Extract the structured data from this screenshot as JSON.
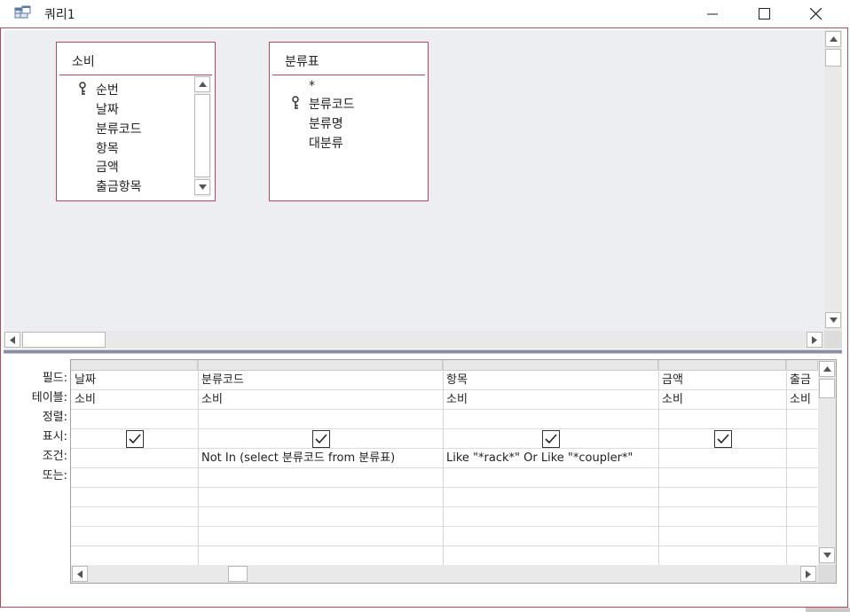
{
  "window": {
    "title": "쿼리1",
    "icon": "query-icon"
  },
  "tables": [
    {
      "title": "소비",
      "fields": [
        {
          "name": "순번",
          "key": true
        },
        {
          "name": "날짜",
          "key": false
        },
        {
          "name": "분류코드",
          "key": false
        },
        {
          "name": "항목",
          "key": false
        },
        {
          "name": "금액",
          "key": false
        },
        {
          "name": "출금항목",
          "key": false
        }
      ]
    },
    {
      "title": "분류표",
      "fields": [
        {
          "name": "*",
          "key": false
        },
        {
          "name": "분류코드",
          "key": true
        },
        {
          "name": "분류명",
          "key": false
        },
        {
          "name": "대분류",
          "key": false
        }
      ]
    }
  ],
  "grid": {
    "row_labels": [
      "필드:",
      "테이블:",
      "정렬:",
      "표시:",
      "조건:",
      "또는:"
    ],
    "columns": [
      {
        "field": "날짜",
        "table": "소비",
        "sort": "",
        "show": true,
        "criteria": ""
      },
      {
        "field": "분류코드",
        "table": "소비",
        "sort": "",
        "show": true,
        "criteria": "Not In (select 분류코드 from 분류표)"
      },
      {
        "field": "항목",
        "table": "소비",
        "sort": "",
        "show": true,
        "criteria": "Like \"*rack*\" Or Like \"*coupler*\""
      },
      {
        "field": "금액",
        "table": "소비",
        "sort": "",
        "show": true,
        "criteria": ""
      },
      {
        "field": "출금",
        "table": "소비",
        "sort": "",
        "show": false,
        "criteria": ""
      }
    ]
  },
  "colors": {
    "accent": "#b04a5c",
    "pane_bg": "#eceef1"
  }
}
